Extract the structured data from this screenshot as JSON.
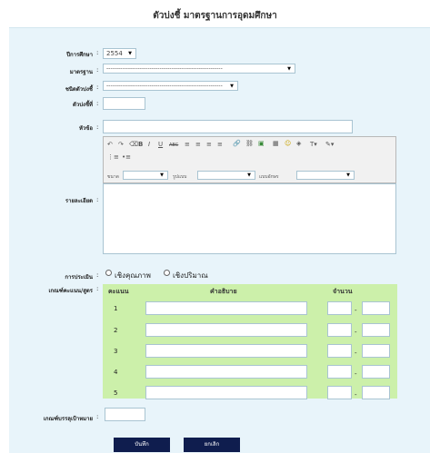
{
  "page_title": "ตัวบ่งชี้ มาตรฐานการอุดมศึกษา",
  "form": {
    "year_label": "ปีการศึกษา",
    "year_value": "2554",
    "standard_label": "มาตรฐาน",
    "standard_value": "-----------------------------------------------------------",
    "indicator_type_label": "ชนิดตัวบ่งชี้",
    "indicator_type_value": "-----------------------------------------------------------",
    "indicator_no_label": "ตัวบ่งชี้ที่",
    "indicator_no_value": "",
    "topic_label": "หัวข้อ",
    "topic_value": "",
    "detail_label": "รายละเอียด",
    "detail_value": "",
    "eval_label": "การประเมิน",
    "eval_options": [
      "เชิงคุณภาพ",
      "เชิงปริมาณ"
    ],
    "criteria_label": "เกณฑ์คะแนน/สูตร",
    "target_label": "เกณฑ์บรรลุเป้าหมาย",
    "target_value": ""
  },
  "editor": {
    "size_label": "ขนาด",
    "format_label": "รูปแบบ",
    "font_label": "แบบอักษร",
    "size_value": "",
    "format_value": "",
    "font_value": ""
  },
  "criteria_table": {
    "headers": [
      "คะแนน",
      "คำอธิบาย",
      "จำนวน"
    ],
    "rows": [
      {
        "score": "1",
        "description": "",
        "from": "",
        "to": ""
      },
      {
        "score": "2",
        "description": "",
        "from": "",
        "to": ""
      },
      {
        "score": "3",
        "description": "",
        "from": "",
        "to": ""
      },
      {
        "score": "4",
        "description": "",
        "from": "",
        "to": ""
      },
      {
        "score": "5",
        "description": "",
        "from": "",
        "to": ""
      }
    ],
    "range_separator": "-"
  },
  "buttons": {
    "save": "บันทึก",
    "cancel": "ยกเลิก"
  }
}
